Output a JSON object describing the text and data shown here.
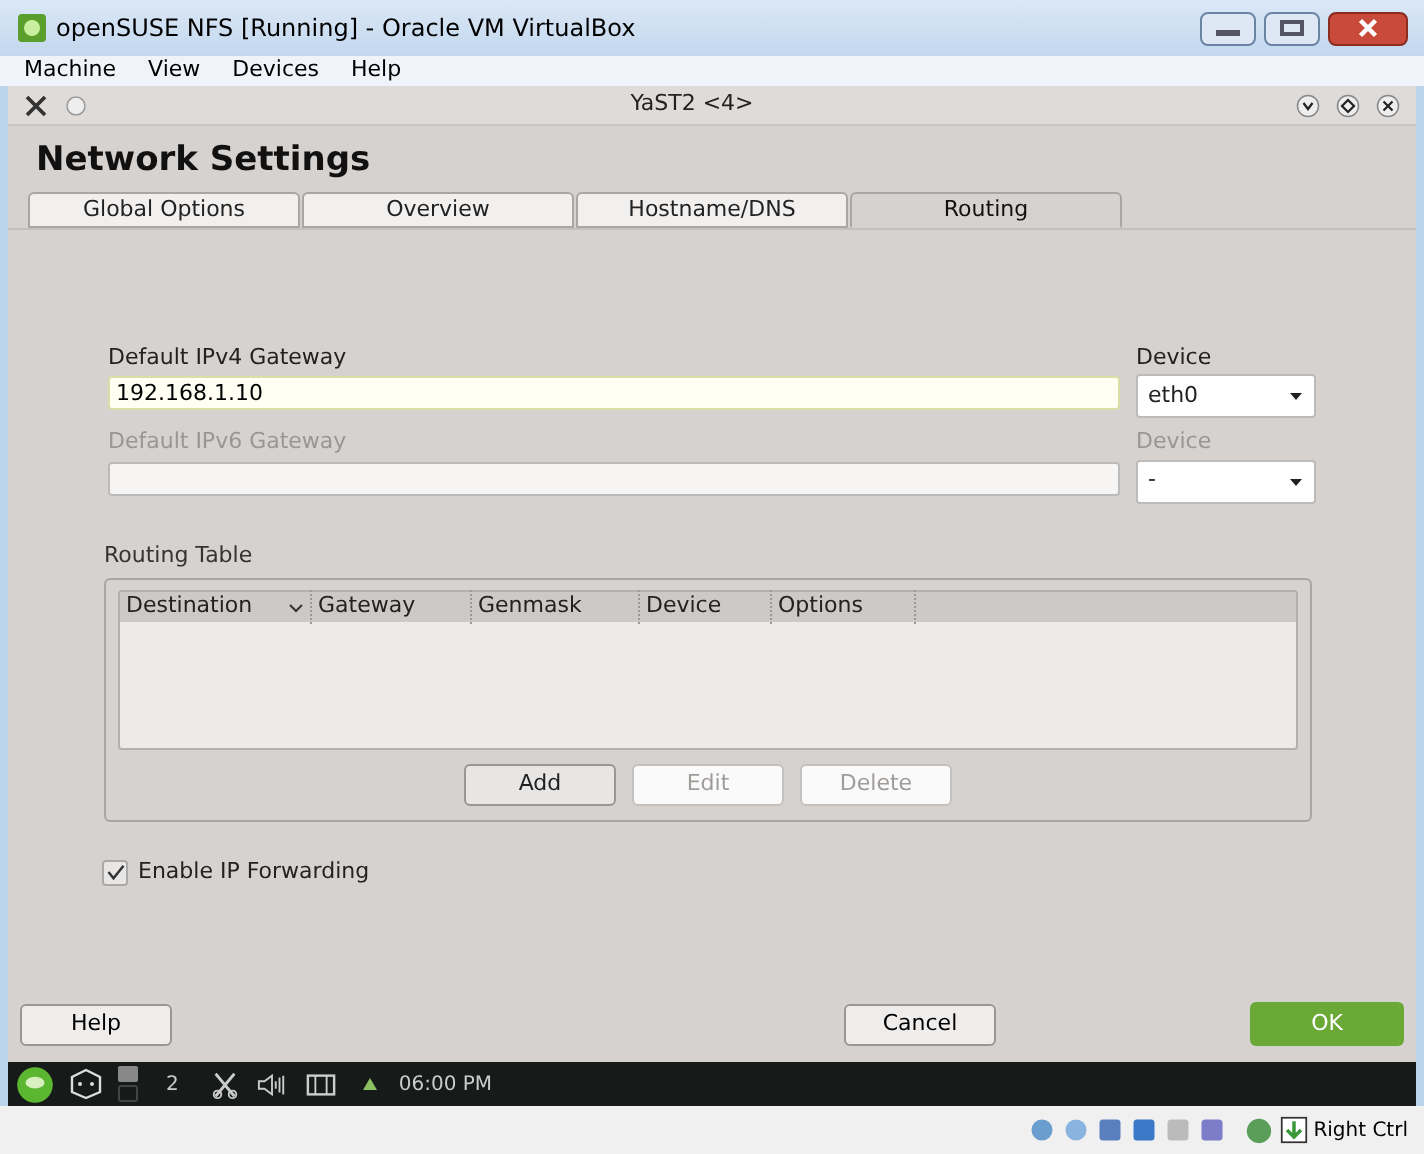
{
  "window": {
    "title": "openSUSE NFS [Running] - Oracle VM VirtualBox"
  },
  "menu": [
    "Machine",
    "View",
    "Devices",
    "Help"
  ],
  "yast_title": "YaST2 <4>",
  "heading": "Network Settings",
  "tabs": [
    {
      "label": "Global Options",
      "selected": false
    },
    {
      "label": "Overview",
      "selected": false
    },
    {
      "label": "Hostname/DNS",
      "selected": false
    },
    {
      "label": "Routing",
      "selected": true
    }
  ],
  "gateways": [
    {
      "label": "Default IPv4 Gateway",
      "value": "192.168.1.10",
      "disabled": false,
      "device_label": "Device",
      "device": "eth0"
    },
    {
      "label": "Default IPv6 Gateway",
      "disabled": true,
      "device_label": "Device",
      "device": "-"
    }
  ],
  "routing_table": {
    "title": "Routing Table",
    "columns": [
      "Destination",
      "Gateway",
      "Genmask",
      "Device",
      "Options"
    ],
    "buttons": [
      {
        "label": "Add",
        "disabled": false
      },
      {
        "label": "Edit",
        "disabled": true
      },
      {
        "label": "Delete",
        "disabled": true
      }
    ]
  },
  "ip_forwarding": {
    "label": "Enable IP Forwarding",
    "checked": true
  },
  "footer": {
    "help": "Help",
    "cancel": "Cancel",
    "ok": "OK"
  },
  "taskbar": {
    "desktop": "2",
    "time": "06:00 PM"
  },
  "status_bar": {
    "host_key": "Right Ctrl"
  }
}
